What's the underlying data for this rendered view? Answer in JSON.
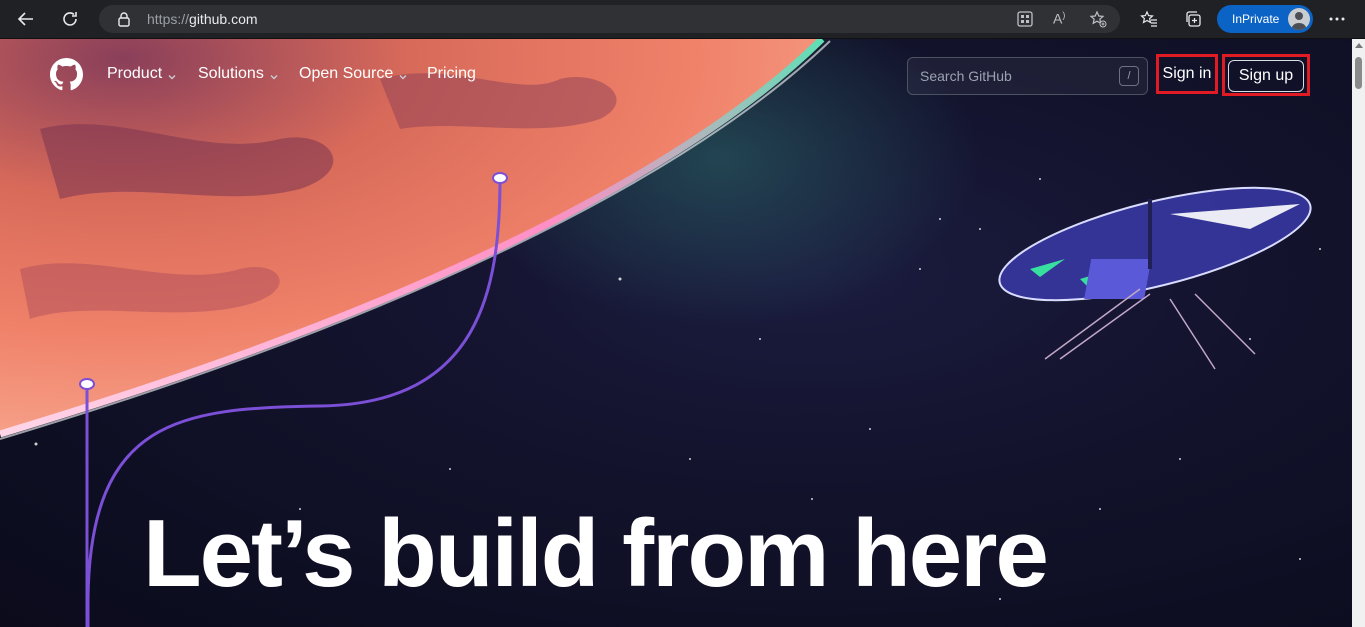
{
  "browser": {
    "url_prefix": "https://",
    "url_host": "github.com",
    "profile_label": "InPrivate"
  },
  "nav": {
    "items": [
      {
        "label": "Product",
        "has_dropdown": true
      },
      {
        "label": "Solutions",
        "has_dropdown": true
      },
      {
        "label": "Open Source",
        "has_dropdown": true
      },
      {
        "label": "Pricing",
        "has_dropdown": false
      }
    ],
    "search_placeholder": "Search GitHub",
    "search_shortcut": "/",
    "sign_in": "Sign in",
    "sign_up": "Sign up"
  },
  "hero": {
    "headline": "Let’s build from here"
  },
  "colors": {
    "highlight_box": "#e01b24",
    "inprivate_blue": "#0b63c5"
  }
}
